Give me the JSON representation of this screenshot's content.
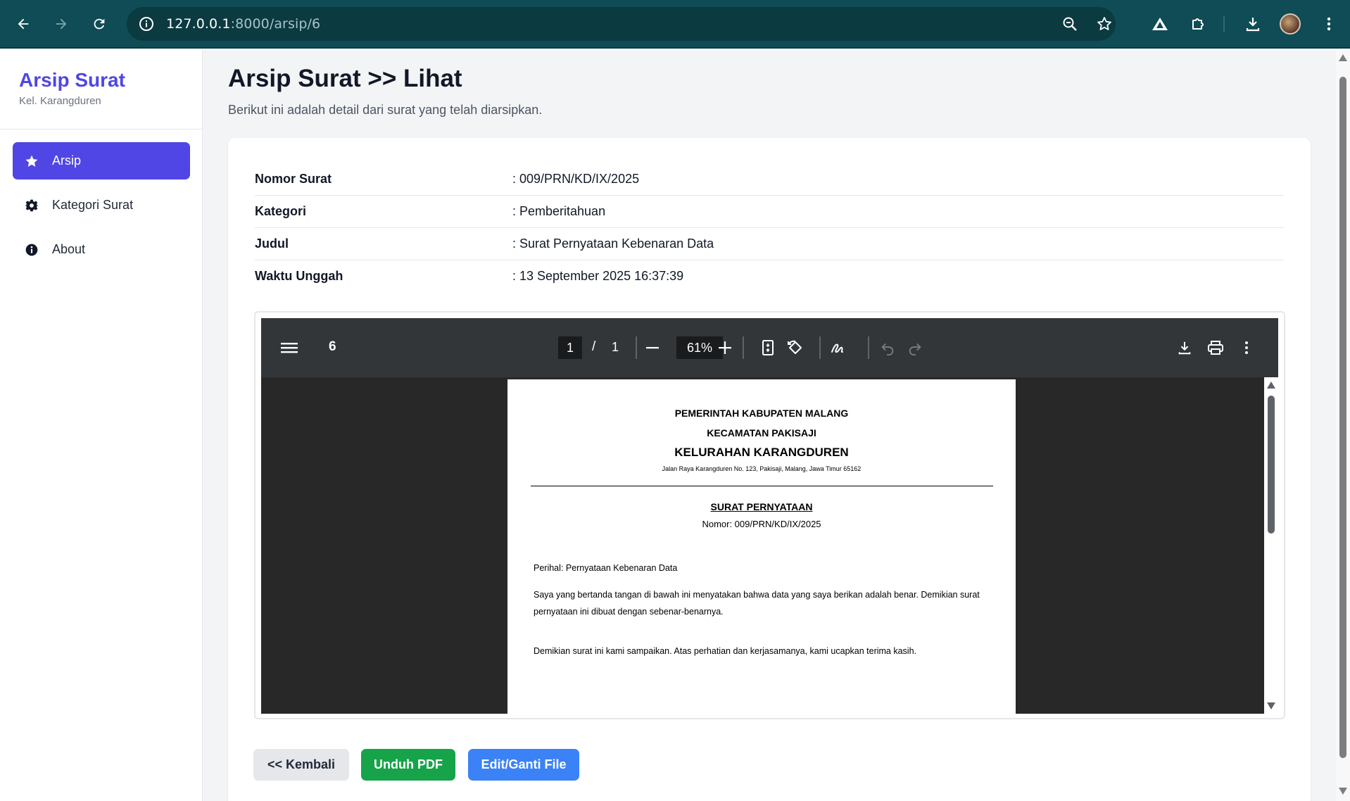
{
  "browser": {
    "url_host": "127.0.0.1",
    "url_rest": ":8000/arsip/6"
  },
  "sidebar": {
    "brand_title": "Arsip Surat",
    "brand_subtitle": "Kel. Karangduren",
    "items": [
      {
        "label": "Arsip",
        "icon": "star-icon",
        "active": true
      },
      {
        "label": "Kategori Surat",
        "icon": "gear-icon",
        "active": false
      },
      {
        "label": "About",
        "icon": "info-icon",
        "active": false
      }
    ]
  },
  "main": {
    "title": "Arsip Surat >> Lihat",
    "subtitle": "Berikut ini adalah detail dari surat yang telah diarsipkan.",
    "details": [
      {
        "label": "Nomor Surat",
        "value": ": 009/PRN/KD/IX/2025"
      },
      {
        "label": "Kategori",
        "value": ": Pemberitahuan"
      },
      {
        "label": "Judul",
        "value": ": Surat Pernyataan Kebenaran Data"
      },
      {
        "label": "Waktu Unggah",
        "value": ": 13 September 2025 16:37:39"
      }
    ],
    "buttons": {
      "back": "<< Kembali",
      "download": "Unduh PDF",
      "edit": "Edit/Ganti File"
    }
  },
  "pdf_viewer": {
    "title": "6",
    "current_page": "1",
    "page_separator": "/",
    "total_pages": "1",
    "zoom": "61%"
  },
  "pdf_document": {
    "line1": "PEMERINTAH KABUPATEN MALANG",
    "line2": "KECAMATAN PAKISAJI",
    "line3": "KELURAHAN KARANGDUREN",
    "address": "Jalan Raya Karangduren No. 123, Pakisaji, Malang, Jawa Timur 65162",
    "doc_title": "SURAT PERNYATAAN",
    "doc_number": "Nomor: 009/PRN/KD/IX/2025",
    "perihal": "Perihal: Pernyataan Kebenaran Data",
    "body": "Saya yang bertanda tangan di bawah ini menyatakan bahwa data yang saya berikan adalah benar. Demikian surat pernyataan ini dibuat dengan sebenar-benarnya.",
    "closing": "Demikian surat ini kami sampaikan. Atas perhatian dan kerjasamanya, kami ucapkan terima kasih."
  }
}
